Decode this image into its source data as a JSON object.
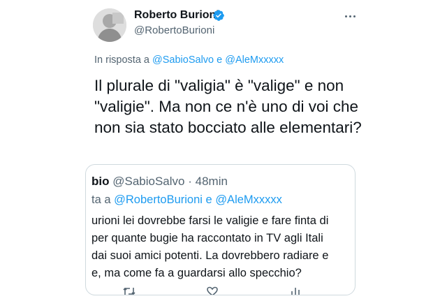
{
  "author": {
    "display_name": "Roberto Burioni",
    "handle": "@RobertoBurioni",
    "verified": true
  },
  "reply": {
    "prefix": "In risposta a",
    "user1": "@SabioSalvo",
    "joiner": "e",
    "user2": "@AleMxxxxx"
  },
  "tweet": {
    "text": "Il plurale di \"valigia\" è \"valige\" e non \"valigie\". Ma non ce n'è uno di voi che non sia stato bocciato alle elementari?"
  },
  "quoted": {
    "name": "bio",
    "handle": "@SabioSalvo",
    "separator": "·",
    "time": "48min",
    "reply_prefix": "ta a",
    "reply_user1": "@RobertoBurioni",
    "reply_joiner": "e",
    "reply_user2": "@AleMxxxxx",
    "body_lines": [
      "urioni lei dovrebbe farsi le valigie e fare finta di",
      "per quante bugie ha raccontato in TV agli Itali",
      "dai suoi amici potenti. La dovrebbero radiare e",
      "e, ma come fa a guardarsi allo specchio?"
    ]
  },
  "icons": {
    "more": "more-options-icon",
    "verified": "verified-badge-icon",
    "reply": "reply-icon",
    "retweet": "retweet-icon",
    "like": "like-icon",
    "share": "share-icon"
  },
  "colors": {
    "link": "#1d9bf0",
    "muted": "#536471",
    "text": "#0f1419",
    "border": "#cfd9de"
  }
}
